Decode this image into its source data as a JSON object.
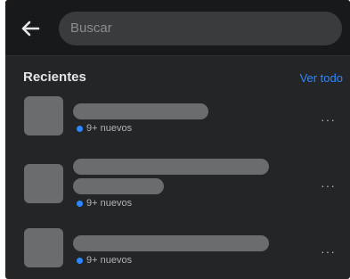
{
  "header": {
    "search_placeholder": "Buscar"
  },
  "section": {
    "title": "Recientes",
    "see_all": "Ver todo"
  },
  "items": [
    {
      "badge": "9+ nuevos",
      "more": "···"
    },
    {
      "badge": "9+ nuevos",
      "more": "···"
    },
    {
      "badge": "9+ nuevos",
      "more": "···"
    }
  ],
  "colors": {
    "accent": "#2d88ff",
    "background": "#242526",
    "placeholder_bar": "#6b6c6e"
  },
  "icons": {
    "back": "arrow-left-icon",
    "more": "more-horizontal-icon",
    "badge": "dot-icon"
  }
}
